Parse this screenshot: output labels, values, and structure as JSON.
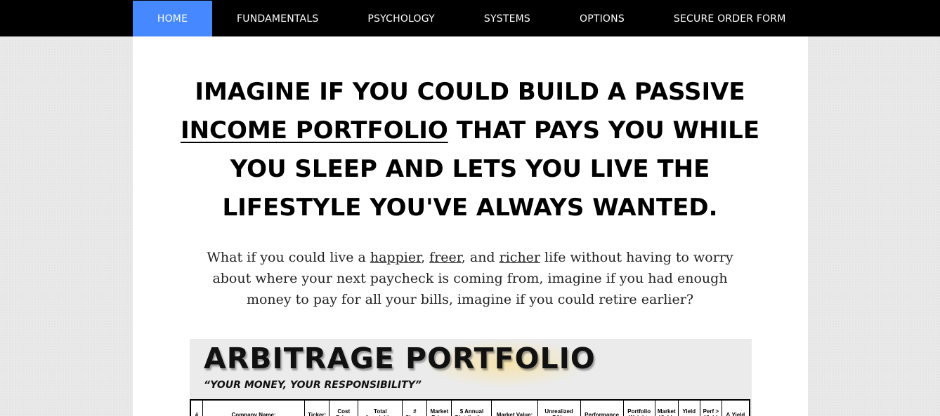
{
  "nav": {
    "items": [
      {
        "label": "HOME",
        "active": true
      },
      {
        "label": "FUNDAMENTALS"
      },
      {
        "label": "PSYCHOLOGY"
      },
      {
        "label": "SYSTEMS"
      },
      {
        "label": "OPTIONS"
      },
      {
        "label": "SECURE ORDER FORM"
      }
    ],
    "active_color": "#4588ff"
  },
  "headline": {
    "part1": "IMAGINE IF YOU COULD BUILD A PASSIVE ",
    "underlined": "INCOME PORTFOLIO",
    "part2": " THAT PAYS YOU WHILE YOU SLEEP AND LETS YOU LIVE THE LIFESTYLE YOU'VE ALWAYS WANTED."
  },
  "subtext": {
    "part1": "What if you could live a ",
    "link1": "happier",
    "sep1": ", ",
    "link2": "freer",
    "sep2": ", and ",
    "link3": "richer",
    "part2": " life without having to worry about where your next paycheck is coming from, imagine if you had enough money to pay for all your bills, imagine if you could retire earlier?"
  },
  "banner": {
    "title": "ARBITRAGE PORTFOLIO",
    "tagline": "“YOUR MONEY, YOUR RESPONSIBILITY”",
    "columns": [
      "#",
      "Company Name:",
      "Ticker:",
      "Cost Price:",
      "Total Acquisition",
      "# Shares",
      "Market Price:",
      "$ Annual Distribution:",
      "Market Value:",
      "Unrealized P&L:",
      "Performance",
      "Portfolio Weight:",
      "Market Yield:",
      "Yield on",
      "Perf > Yield",
      "Δ Yield"
    ]
  }
}
